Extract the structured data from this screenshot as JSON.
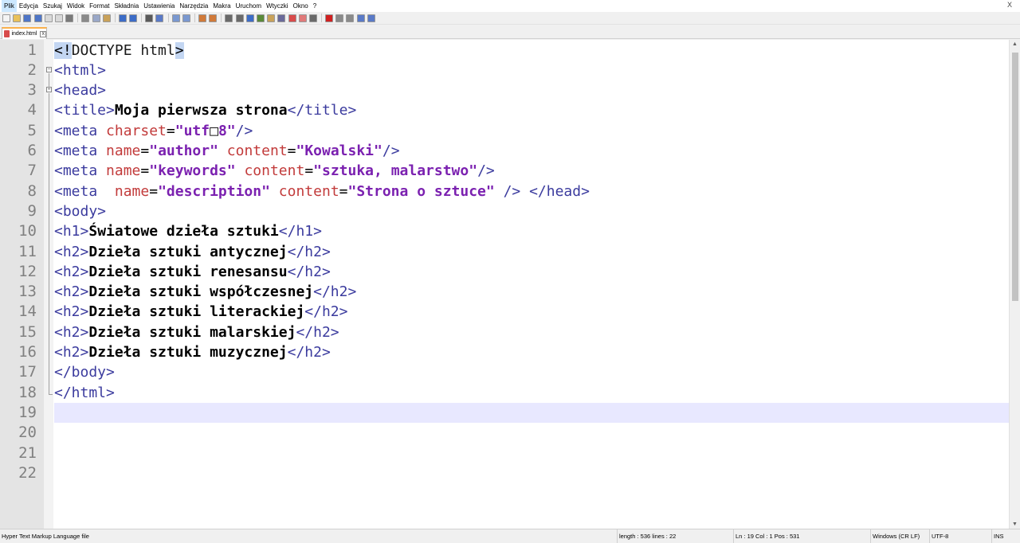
{
  "menubar": {
    "items": [
      "Plik",
      "Edycja",
      "Szukaj",
      "Widok",
      "Format",
      "Składnia",
      "Ustawienia",
      "Narzędzia",
      "Makra",
      "Uruchom",
      "Wtyczki",
      "Okno",
      "?"
    ],
    "close_glyph": "X"
  },
  "toolbar": {
    "buttons": [
      {
        "icon": "new-file-icon",
        "color": "#f4f4f4"
      },
      {
        "icon": "open-file-icon",
        "color": "#e9c15a"
      },
      {
        "icon": "save-icon",
        "color": "#4f76c7"
      },
      {
        "icon": "save-all-icon",
        "color": "#4f76c7"
      },
      {
        "icon": "close-file-icon",
        "color": "#d9d9d9"
      },
      {
        "icon": "close-all-icon",
        "color": "#d9d9d9"
      },
      {
        "icon": "print-icon",
        "color": "#7a7a7a"
      },
      {
        "sep": true
      },
      {
        "icon": "cut-icon",
        "color": "#8a8a8a"
      },
      {
        "icon": "copy-icon",
        "color": "#9aa8c8"
      },
      {
        "icon": "paste-icon",
        "color": "#c9a25a"
      },
      {
        "sep": true
      },
      {
        "icon": "undo-icon",
        "color": "#3d6dc7"
      },
      {
        "icon": "redo-icon",
        "color": "#3d6dc7"
      },
      {
        "sep": true
      },
      {
        "icon": "find-icon",
        "color": "#5a5a5a"
      },
      {
        "icon": "replace-icon",
        "color": "#5a7ac7"
      },
      {
        "sep": true
      },
      {
        "icon": "zoom-in-icon",
        "color": "#7a98d0"
      },
      {
        "icon": "zoom-out-icon",
        "color": "#7a98d0"
      },
      {
        "sep": true
      },
      {
        "icon": "sync-vertical-icon",
        "color": "#d07a3a"
      },
      {
        "icon": "sync-horizontal-icon",
        "color": "#d07a3a"
      },
      {
        "sep": true
      },
      {
        "icon": "word-wrap-icon",
        "color": "#6a6a6a"
      },
      {
        "icon": "show-all-chars-icon",
        "color": "#6a6a6a"
      },
      {
        "icon": "indent-guide-icon",
        "color": "#3d6dc7"
      },
      {
        "icon": "user-lang-icon",
        "color": "#5a8a3a"
      },
      {
        "icon": "doc-map-icon",
        "color": "#c9a25a"
      },
      {
        "icon": "function-list-icon",
        "color": "#6a6a9a"
      },
      {
        "icon": "folder-workspace-icon",
        "color": "#d84b4b"
      },
      {
        "icon": "monitoring-icon",
        "color": "#e07a7a"
      },
      {
        "icon": "preview-icon",
        "color": "#6a6a6a"
      },
      {
        "sep": true
      },
      {
        "icon": "record-macro-icon",
        "color": "#d02020"
      },
      {
        "icon": "stop-macro-icon",
        "color": "#8a8a8a"
      },
      {
        "icon": "play-macro-icon",
        "color": "#8a8a8a"
      },
      {
        "icon": "run-macro-multiple-icon",
        "color": "#5a7ac7"
      },
      {
        "icon": "save-macro-icon",
        "color": "#5a7ac7"
      }
    ]
  },
  "tab": {
    "label": "index.html",
    "close_glyph": "x"
  },
  "editor": {
    "line_numbers": [
      "1",
      "2",
      "3",
      "4",
      "5",
      "6",
      "7",
      "8",
      "9",
      "10",
      "11",
      "12",
      "13",
      "14",
      "15",
      "16",
      "17",
      "18",
      "19",
      "20",
      "21",
      "22"
    ],
    "current_line_index": 18,
    "lines": [
      [
        {
          "c": "t-hl",
          "t": "<!"
        },
        {
          "c": "t-doc",
          "t": "DOCTYPE html"
        },
        {
          "c": "t-hl",
          "t": ">"
        }
      ],
      [
        {
          "c": "t-tag",
          "t": "<html>"
        }
      ],
      [
        {
          "c": "t-tag",
          "t": "<head>"
        }
      ],
      [
        {
          "c": "t-tag",
          "t": "<title>"
        },
        {
          "c": "t-txt",
          "t": "Moja pierwsza strona"
        },
        {
          "c": "t-tag",
          "t": "</title>"
        }
      ],
      [
        {
          "c": "t-tag",
          "t": "<meta "
        },
        {
          "c": "t-attr",
          "t": "charset"
        },
        {
          "c": "t-op",
          "t": "="
        },
        {
          "c": "t-str",
          "t": "\"utf"
        },
        {
          "c": "t-doc",
          "t": "□"
        },
        {
          "c": "t-str",
          "t": "8\""
        },
        {
          "c": "t-tag",
          "t": "/>"
        }
      ],
      [
        {
          "c": "t-tag",
          "t": "<meta "
        },
        {
          "c": "t-attr",
          "t": "name"
        },
        {
          "c": "t-op",
          "t": "="
        },
        {
          "c": "t-str",
          "t": "\"author\""
        },
        {
          "c": "t-tag",
          "t": " "
        },
        {
          "c": "t-attr",
          "t": "content"
        },
        {
          "c": "t-op",
          "t": "="
        },
        {
          "c": "t-str",
          "t": "\"Kowalski\""
        },
        {
          "c": "t-tag",
          "t": "/>"
        }
      ],
      [
        {
          "c": "t-tag",
          "t": "<meta "
        },
        {
          "c": "t-attr",
          "t": "name"
        },
        {
          "c": "t-op",
          "t": "="
        },
        {
          "c": "t-str",
          "t": "\"keywords\""
        },
        {
          "c": "t-tag",
          "t": " "
        },
        {
          "c": "t-attr",
          "t": "content"
        },
        {
          "c": "t-op",
          "t": "="
        },
        {
          "c": "t-str",
          "t": "\"sztuka, malarstwo\""
        },
        {
          "c": "t-tag",
          "t": "/>"
        }
      ],
      [
        {
          "c": "t-tag",
          "t": "<meta  "
        },
        {
          "c": "t-attr",
          "t": "name"
        },
        {
          "c": "t-op",
          "t": "="
        },
        {
          "c": "t-str",
          "t": "\"description\""
        },
        {
          "c": "t-tag",
          "t": " "
        },
        {
          "c": "t-attr",
          "t": "content"
        },
        {
          "c": "t-op",
          "t": "="
        },
        {
          "c": "t-str",
          "t": "\"Strona o sztuce\""
        },
        {
          "c": "t-tag",
          "t": " /> </head>"
        }
      ],
      [
        {
          "c": "t-tag",
          "t": "<body>"
        }
      ],
      [
        {
          "c": "t-tag",
          "t": "<h1>"
        },
        {
          "c": "t-txt",
          "t": "Światowe dzieła sztuki"
        },
        {
          "c": "t-tag",
          "t": "</h1>"
        }
      ],
      [
        {
          "c": "t-tag",
          "t": "<h2>"
        },
        {
          "c": "t-txt",
          "t": "Dzieła sztuki antycznej"
        },
        {
          "c": "t-tag",
          "t": "</h2>"
        }
      ],
      [
        {
          "c": "t-tag",
          "t": "<h2>"
        },
        {
          "c": "t-txt",
          "t": "Dzieła sztuki renesansu"
        },
        {
          "c": "t-tag",
          "t": "</h2>"
        }
      ],
      [
        {
          "c": "t-tag",
          "t": "<h2>"
        },
        {
          "c": "t-txt",
          "t": "Dzieła sztuki współczesnej"
        },
        {
          "c": "t-tag",
          "t": "</h2>"
        }
      ],
      [
        {
          "c": "t-tag",
          "t": "<h2>"
        },
        {
          "c": "t-txt",
          "t": "Dzieła sztuki literackiej"
        },
        {
          "c": "t-tag",
          "t": "</h2>"
        }
      ],
      [
        {
          "c": "t-tag",
          "t": "<h2>"
        },
        {
          "c": "t-txt",
          "t": "Dzieła sztuki malarskiej"
        },
        {
          "c": "t-tag",
          "t": "</h2>"
        }
      ],
      [
        {
          "c": "t-tag",
          "t": "<h2>"
        },
        {
          "c": "t-txt",
          "t": "Dzieła sztuki muzycznej"
        },
        {
          "c": "t-tag",
          "t": "</h2>"
        }
      ],
      [
        {
          "c": "t-tag",
          "t": "</body>"
        }
      ],
      [
        {
          "c": "t-tag",
          "t": "</html>"
        }
      ],
      [],
      [],
      [],
      []
    ]
  },
  "statusbar": {
    "file_type": "Hyper Text Markup Language file",
    "length": "length : 536    lines : 22",
    "position": "Ln : 19    Col : 1    Pos : 531",
    "eol": "Windows (CR LF)",
    "encoding": "UTF-8",
    "mode": "INS"
  }
}
